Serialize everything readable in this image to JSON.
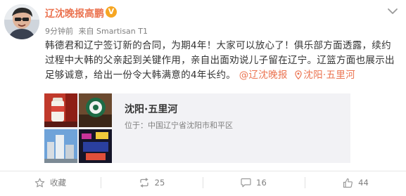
{
  "post": {
    "author": "辽沈晚报高鹏",
    "verified_badge": "V",
    "time": "9分钟前",
    "source": "来自 Smartisan T1",
    "text_main": "韩德君和辽宁签订新的合同，为期4年！大家可以放心了！俱乐部方面透露，续约过程中大韩的父亲起到关键作用，亲自出面劝说儿子留在辽宁。辽篮方面也展示出足够诚意，给出一份令大韩满意的4年长约。",
    "mention": "@辽沈晚报",
    "location_link": "沈阳·五里河"
  },
  "location_card": {
    "title": "沈阳·五里河",
    "address": "位于：中国辽宁省沈阳市和平区"
  },
  "actions": {
    "favorite_label": "收藏",
    "repost_count": "25",
    "comment_count": "16",
    "like_count": "44"
  },
  "icons": {
    "avatar": "user-avatar",
    "verified": "verified-badge-icon",
    "menu": "chevron-down-icon",
    "location": "location-pin-icon",
    "favorite": "star-icon",
    "repost": "repost-icon",
    "comment": "comment-icon",
    "like": "thumbs-up-icon"
  },
  "colors": {
    "accent": "#eb7350",
    "badge": "#f6a623",
    "muted": "#808080",
    "card_bg": "#f2f2f5"
  }
}
